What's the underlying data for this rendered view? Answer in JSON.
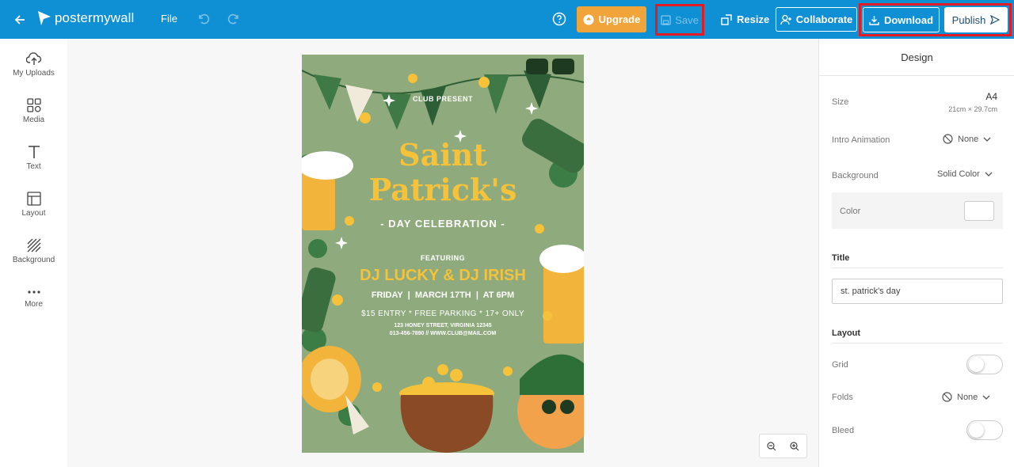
{
  "app": {
    "logo_text": "postermywall",
    "colors": {
      "topbar": "#0f8fd4",
      "upgrade": "#f0a43a",
      "highlight": "#e31b23",
      "poster_bg": "#8faa7d",
      "poster_yellow": "#f5c23a"
    }
  },
  "topbar": {
    "file_label": "File",
    "upgrade_label": "Upgrade",
    "save_label": "Save",
    "resize_label": "Resize",
    "collaborate_label": "Collaborate",
    "download_label": "Download",
    "publish_label": "Publish"
  },
  "sidebar": {
    "items": [
      {
        "label": "My Uploads",
        "icon": "upload-cloud-icon"
      },
      {
        "label": "Media",
        "icon": "media-icon"
      },
      {
        "label": "Text",
        "icon": "text-icon"
      },
      {
        "label": "Layout",
        "icon": "layout-icon"
      },
      {
        "label": "Background",
        "icon": "background-icon"
      },
      {
        "label": "More",
        "icon": "more-icon"
      }
    ]
  },
  "poster": {
    "club_present": "CLUB PRESENT",
    "title_line1": "Saint",
    "title_line2": "Patrick's",
    "subtitle": "- DAY CELEBRATION -",
    "featuring": "FEATURING",
    "djs": "DJ LUCKY & DJ IRISH",
    "date_line": "FRIDAY  |  MARCH 17TH  |  AT 6PM",
    "entry_line": "$15 ENTRY * FREE PARKING * 17+ ONLY",
    "address_line": "123 HONEY STREET, VIRGINIA 12345",
    "contact_line": "013-456-7890 // WWW.CLUB@MAIL.COM"
  },
  "panel": {
    "title": "Design",
    "size_label": "Size",
    "size_value": "A4",
    "size_dims": "21cm × 29.7cm",
    "intro_label": "Intro Animation",
    "intro_value": "None",
    "background_label": "Background",
    "background_value": "Solid Color",
    "color_label": "Color",
    "title_section": "Title",
    "title_value": "st. patrick's day",
    "layout_section": "Layout",
    "grid_label": "Grid",
    "folds_label": "Folds",
    "folds_value": "None",
    "bleed_label": "Bleed"
  }
}
